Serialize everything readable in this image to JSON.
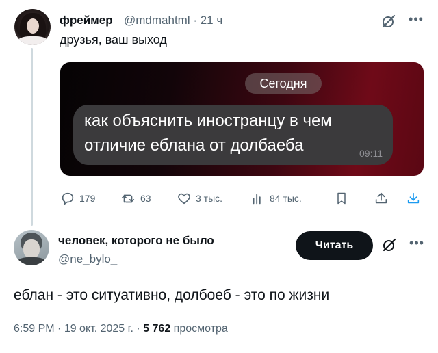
{
  "tweet1": {
    "author_name": "фреймер",
    "handle": "@mdmahtml",
    "age": "21 ч",
    "text": "друзья, ваш выход",
    "media": {
      "date_pill": "Сегодня",
      "message_line1": "как объяснить иностранцу в чем",
      "message_line2": "отличие еблана от долбаеба",
      "message_time": "09:11"
    },
    "actions": {
      "replies": "179",
      "reposts": "63",
      "likes": "3 тыс.",
      "views": "84 тыс."
    }
  },
  "tweet2": {
    "author_name": "человек, которого не было",
    "handle": "@ne_bylo_",
    "follow_label": "Читать",
    "text": "еблан - это ситуативно, долбоеб - это по жизни",
    "time": "6:59 PM",
    "date": "19 окт. 2025 г.",
    "views_count": "5 762",
    "views_label": "просмотра"
  },
  "separators": {
    "dot": " · "
  },
  "colors": {
    "secondary": "#536471",
    "primary": "#0f1419",
    "accent": "#1d9bf0"
  },
  "icons": [
    "grok-icon",
    "more-icon",
    "reply-icon",
    "repost-icon",
    "like-icon",
    "views-icon",
    "bookmark-icon",
    "share-icon",
    "download-icon"
  ]
}
